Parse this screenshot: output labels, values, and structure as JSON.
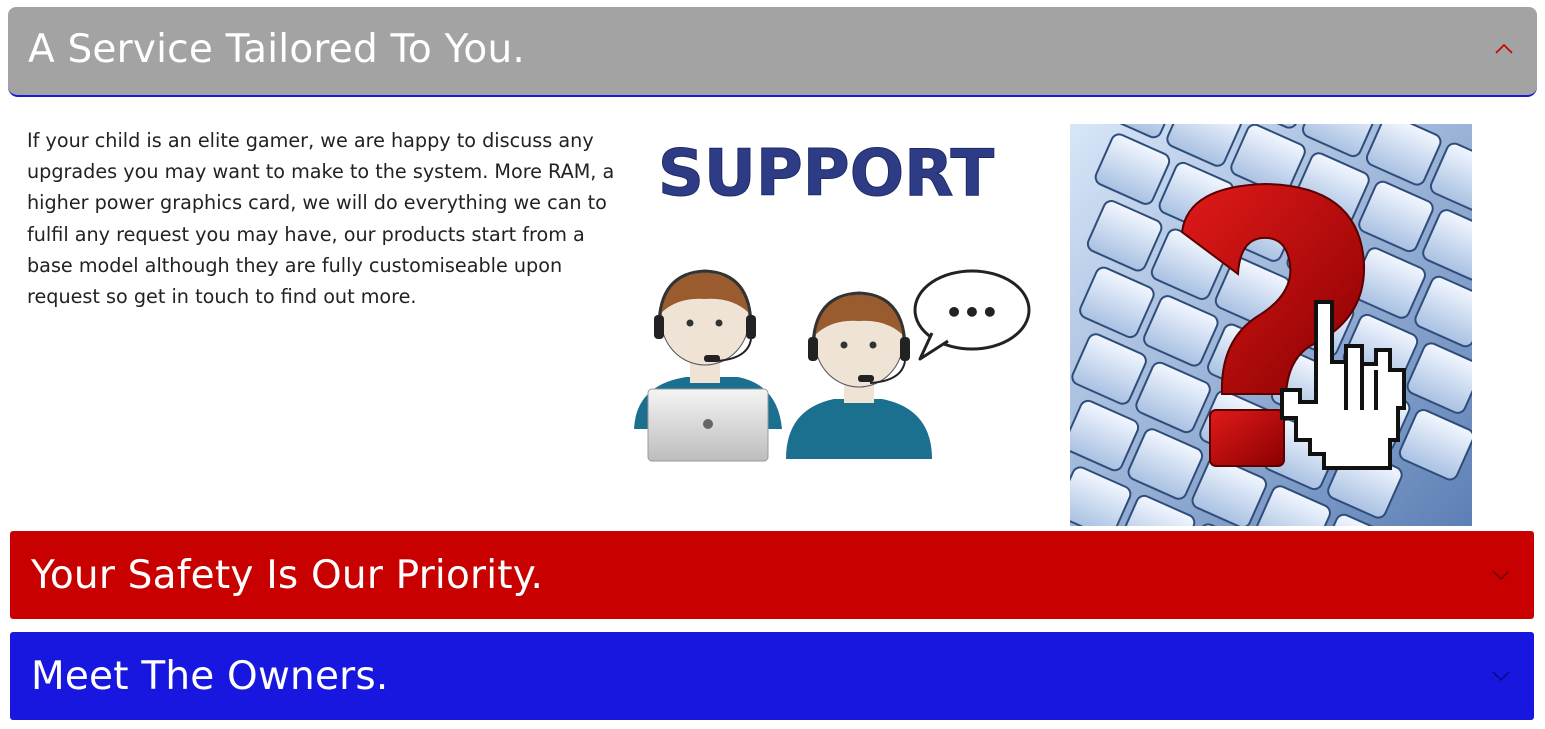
{
  "sections": [
    {
      "title": "A Service Tailored To You.",
      "expanded": true,
      "header_color": "#a3a3a3",
      "chevron_icon": "chevron-up-icon",
      "chevron_color": "#c80000",
      "body_text": "If your child is an elite gamer, we are happy to discuss any upgrades you may want to make to the system. More RAM, a higher power graphics card, we will do everything we can to fulfil any request you may have, our products start from a base model although they are fully customiseable upon request so get in touch to find out more.",
      "support_image": {
        "heading": "SUPPORT",
        "bubble_text": "•••",
        "icon": "support-agents-illustration"
      },
      "keyboard_image": {
        "icon": "keyboard-question-mark-photo"
      }
    },
    {
      "title": "Your Safety Is Our Priority.",
      "expanded": false,
      "header_color": "#c80000",
      "chevron_icon": "chevron-down-icon"
    },
    {
      "title": "Meet The Owners.",
      "expanded": false,
      "header_color": "#1717e0",
      "chevron_icon": "chevron-down-icon"
    }
  ]
}
